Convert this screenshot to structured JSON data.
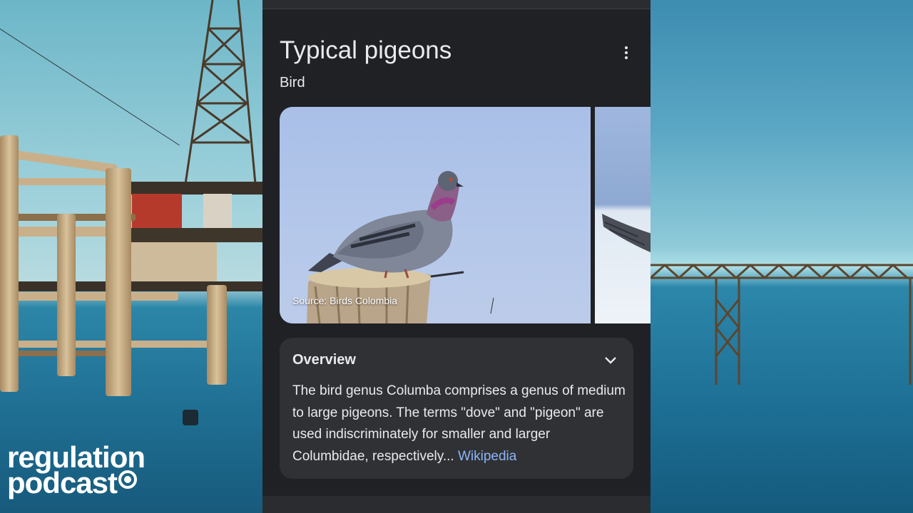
{
  "knowledge_panel": {
    "title": "Typical pigeons",
    "subtitle": "Bird",
    "more_icon": "more-vert-icon",
    "images": [
      {
        "caption": "Source: Birds Colombia",
        "subject": "rock pigeon perched on a wooden post"
      },
      {
        "subject": "bird in flight"
      }
    ],
    "overview": {
      "heading": "Overview",
      "expand_icon": "chevron-down-icon",
      "text": "The bird genus Columba comprises a genus of medium to large pigeons. The terms \"dove\" and \"pigeon\" are used indiscriminately for smaller and larger Columbidae, respectively...",
      "link": "Wikipedia"
    }
  },
  "watermark": {
    "line1": "regulation",
    "line2": "podcast"
  },
  "colors": {
    "panel_bg": "#202124",
    "card_bg": "#303134",
    "text": "#e8eaed",
    "link": "#8ab4f8"
  }
}
